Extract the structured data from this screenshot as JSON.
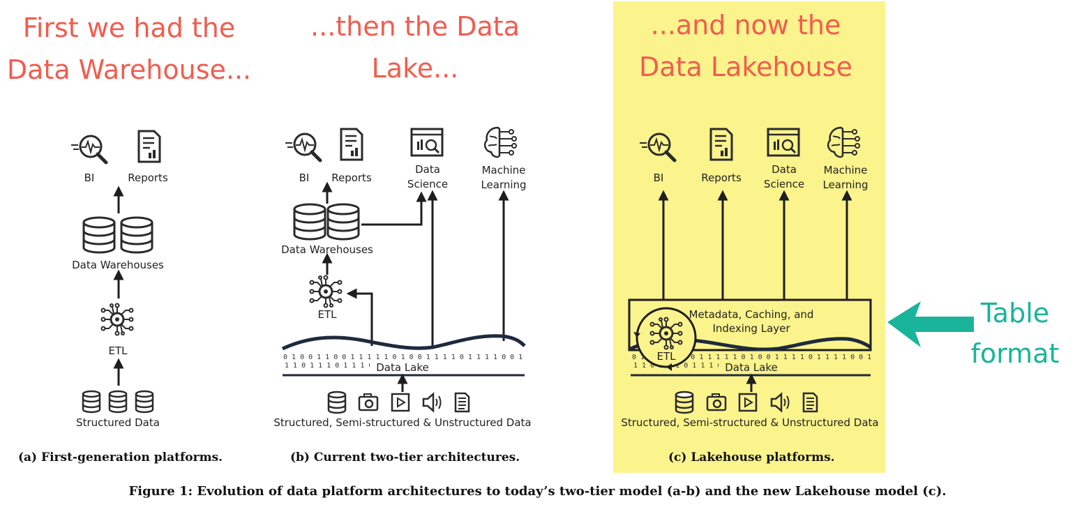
{
  "headlines": {
    "a_line1": "First we had the",
    "a_line2": "Data Warehouse...",
    "b_line1": "...then the Data",
    "b_line2": "Lake...",
    "c_line1": "...and now the",
    "c_line2": "Data Lakehouse"
  },
  "labels": {
    "bi": "BI",
    "reports": "Reports",
    "data_science_1": "Data",
    "data_science_2": "Science",
    "ml_1": "Machine",
    "ml_2": "Learning",
    "data_warehouses": "Data Warehouses",
    "etl": "ETL",
    "structured_data": "Structured Data",
    "data_lake": "Data Lake",
    "all_data": "Structured, Semi-structured & Unstructured Data",
    "metadata_1": "Metadata, Caching, and",
    "metadata_2": "Indexing Layer"
  },
  "annotation": {
    "line1": "Table",
    "line2": "format"
  },
  "captions": {
    "a": "(a) First-generation platforms.",
    "b": "(b) Current two-tier architectures.",
    "c": "(c) Lakehouse platforms.",
    "figure": "Figure 1: Evolution of data platform architectures to today’s two-tier model (a-b) and the new Lakehouse model (c)."
  },
  "colors": {
    "headline": "#f25c4e",
    "highlight": "#fbf38c",
    "annotation": "#19b49a"
  },
  "icons": [
    "bi-magnifier-icon",
    "reports-document-icon",
    "data-science-window-icon",
    "machine-learning-brain-icon",
    "database-icon",
    "etl-chip-icon",
    "camera-icon",
    "play-icon",
    "audio-icon",
    "text-file-icon"
  ]
}
